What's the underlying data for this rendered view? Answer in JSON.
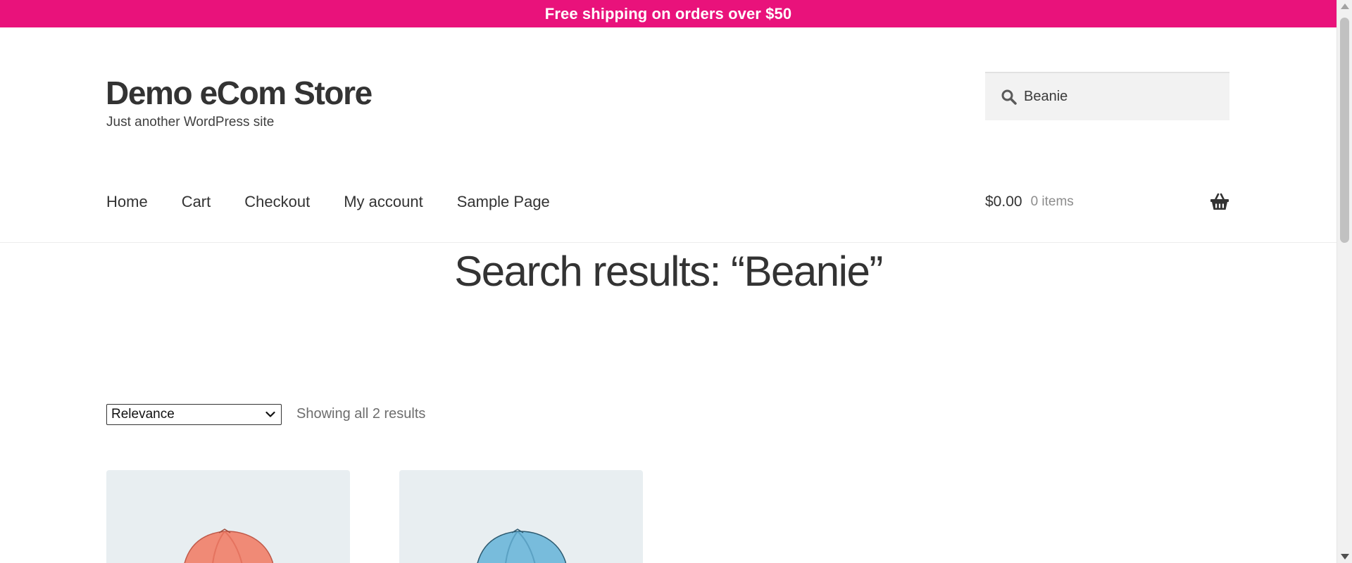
{
  "banner": {
    "text": "Free shipping on orders over $50"
  },
  "header": {
    "site_title": "Demo eCom Store",
    "tagline": "Just another WordPress site",
    "search": {
      "value": "Beanie",
      "placeholder": "Search products…",
      "icon": "search-icon"
    }
  },
  "nav": {
    "items": [
      {
        "label": "Home"
      },
      {
        "label": "Cart"
      },
      {
        "label": "Checkout"
      },
      {
        "label": "My account"
      },
      {
        "label": "Sample Page"
      }
    ]
  },
  "cart": {
    "amount": "$0.00",
    "count": "0 items",
    "icon": "basket-icon"
  },
  "main": {
    "title": "Search results: “Beanie”",
    "sort": {
      "selected": "Relevance"
    },
    "result_count": "Showing all 2 results",
    "products": [
      {
        "image": "beanie-orange",
        "color": "#f08a76"
      },
      {
        "image": "beanie-blue",
        "color": "#78bcdc"
      }
    ]
  },
  "colors": {
    "banner": "#e9127b",
    "text": "#333333",
    "search_bg": "#f2f2f2",
    "product_bg": "#e8eef1"
  }
}
